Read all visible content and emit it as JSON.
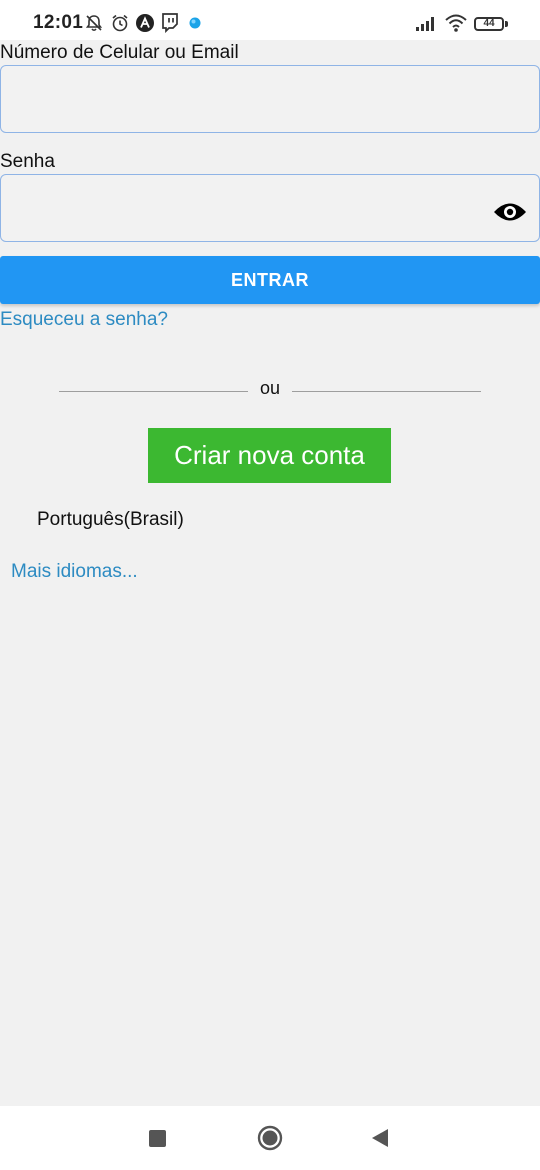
{
  "status_bar": {
    "time": "12:01",
    "battery_level": "44",
    "left_icons": [
      "notifications-off-icon",
      "alarm-icon",
      "app-a-icon",
      "twitch-icon",
      "dot-icon"
    ],
    "right_icons": [
      "signal-icon",
      "wifi-icon",
      "battery-icon"
    ]
  },
  "login": {
    "username_label": "Número de Celular ou Email",
    "username_value": "",
    "password_label": "Senha",
    "password_value": "",
    "submit_label": "ENTRAR",
    "forgot_label": "Esqueceu a senha?"
  },
  "divider": {
    "text": "ou"
  },
  "signup": {
    "create_label": "Criar nova conta"
  },
  "language": {
    "current": "Português(Brasil)",
    "more_label": "Mais idiomas..."
  },
  "colors": {
    "primary": "#2196f3",
    "success": "#3cb831",
    "link": "#2d8bc2",
    "background": "#f1f1f1",
    "input_border": "#8fb4e6"
  },
  "navigation": {
    "buttons": [
      "recents-icon",
      "home-icon",
      "back-icon"
    ]
  }
}
